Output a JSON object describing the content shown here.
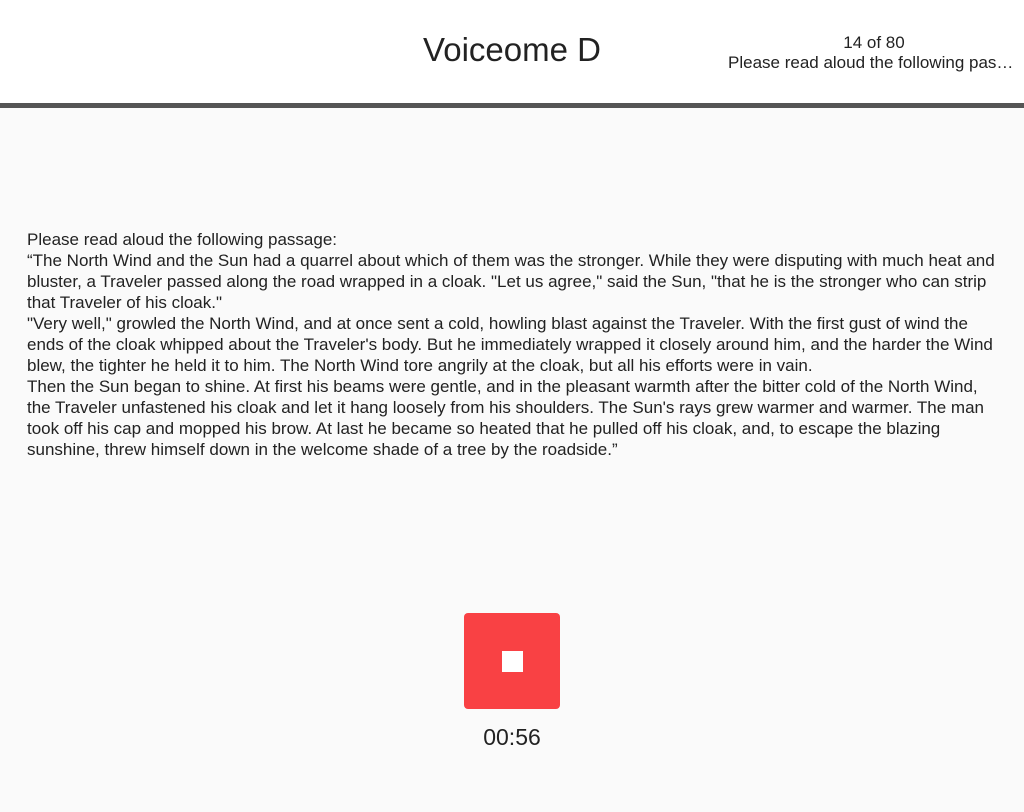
{
  "header": {
    "title": "Voiceome D",
    "progress": "14 of 80",
    "instruction_short": "Please read aloud the following passage:"
  },
  "task": {
    "instruction": "Please read aloud the following passage:",
    "paragraphs": [
      "“The North Wind and the Sun had a quarrel about which of them was the stronger. While they were disputing with much heat and bluster, a Traveler passed along the road wrapped in a cloak. \"Let us agree,\" said the Sun, \"that he is the stronger who can strip that Traveler of his cloak.\"",
      "\"Very well,\" growled the North Wind, and at once sent a cold, howling blast against the Traveler. With the first gust of wind the ends of the cloak whipped about the Traveler's body. But he immediately wrapped it closely around him, and the harder the Wind blew, the tighter he held it to him. The North Wind tore angrily at the cloak, but all his efforts were in vain.",
      "Then the Sun began to shine. At first his beams were gentle, and in the pleasant warmth after the bitter cold of the North Wind, the Traveler unfastened his cloak and let it hang loosely from his shoulders. The Sun's rays grew warmer and warmer. The man took off his cap and mopped his brow. At last he became so heated that he pulled off his cloak, and, to escape the blazing sunshine, threw himself down in the welcome shade of a tree by the roadside.”"
    ]
  },
  "recorder": {
    "stop_icon": "stop-icon",
    "timer": "00:56",
    "button_color": "#f94144"
  }
}
